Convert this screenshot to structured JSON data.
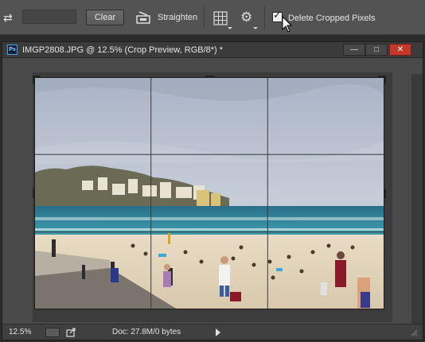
{
  "options_bar": {
    "clear_label": "Clear",
    "straighten_label": "Straighten",
    "delete_cropped_label": "Delete Cropped Pixels",
    "delete_cropped_checked": true,
    "icons": [
      "swap-icon",
      "straighten-icon",
      "grid-overlay-icon",
      "gear-icon",
      "cursor-icon"
    ]
  },
  "document": {
    "title": "IMGP2808.JPG @ 12.5% (Crop Preview, RGB/8*) *",
    "app_icon_text": "Ps",
    "window_buttons": {
      "minimize": "—",
      "restore": "□",
      "close": "✕"
    }
  },
  "status_bar": {
    "zoom": "12.5%",
    "doc_info": "Doc: 27.8M/0 bytes"
  },
  "colors": {
    "options_bg": "#535353",
    "workspace_bg": "#2b2b2b",
    "close_button": "#c0392b"
  }
}
